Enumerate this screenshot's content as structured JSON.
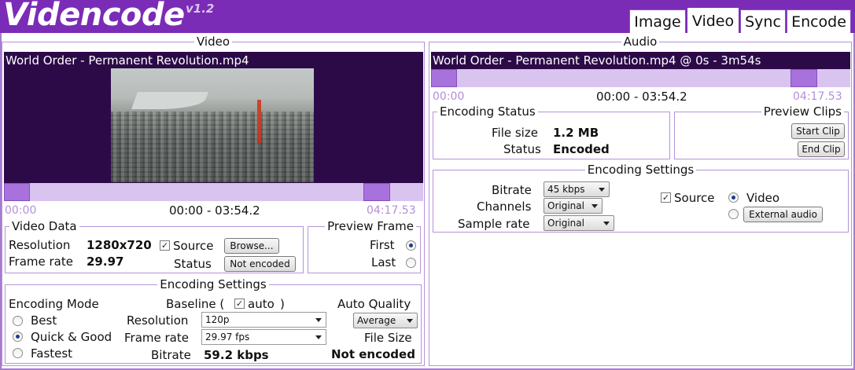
{
  "app": {
    "logo": "Videncode",
    "version": "v1.2"
  },
  "tabs": [
    {
      "label": "Image",
      "active": false
    },
    {
      "label": "Video",
      "active": true
    },
    {
      "label": "Sync",
      "active": false
    },
    {
      "label": "Encode",
      "active": false
    }
  ],
  "video": {
    "legend": "Video",
    "filename": "World Order - Permanent Revolution.mp4",
    "timeline": {
      "start": "00:00",
      "range": "00:00 - 03:54.2",
      "end": "04:17.53"
    },
    "video_data": {
      "legend": "Video Data",
      "resolution_label": "Resolution",
      "resolution_value": "1280x720",
      "framerate_label": "Frame rate",
      "framerate_value": "29.97",
      "source_label": "Source",
      "source_checked": true,
      "browse_button": "Browse...",
      "status_label": "Status",
      "status_button": "Not encoded"
    },
    "preview_frame": {
      "legend": "Preview Frame",
      "first_label": "First",
      "first_selected": true,
      "last_label": "Last",
      "last_selected": false
    },
    "encoding_settings": {
      "legend": "Encoding Settings",
      "mode_label": "Encoding Mode",
      "modes": [
        {
          "label": "Best",
          "selected": false
        },
        {
          "label": "Quick & Good",
          "selected": true
        },
        {
          "label": "Fastest",
          "selected": false
        }
      ],
      "baseline_label": "Baseline (",
      "auto_label": "auto",
      "baseline_close": ")",
      "auto_checked": true,
      "resolution_label": "Resolution",
      "resolution_select": "120p",
      "framerate_label": "Frame rate",
      "framerate_select": "29.97 fps",
      "bitrate_label": "Bitrate",
      "bitrate_value": "59.2 kbps",
      "auto_quality_label": "Auto Quality",
      "auto_quality_select": "Average",
      "file_size_label": "File Size",
      "file_size_value": "Not encoded"
    }
  },
  "audio": {
    "legend": "Audio",
    "title": "World Order - Permanent Revolution.mp4 @ 0s - 3m54s",
    "timeline": {
      "start": "00:00",
      "range": "00:00 - 03:54.2",
      "end": "04:17.53"
    },
    "encoding_status": {
      "legend": "Encoding Status",
      "file_size_label": "File size",
      "file_size_value": "1.2 MB",
      "status_label": "Status",
      "status_value": "Encoded"
    },
    "preview_clips": {
      "legend": "Preview Clips",
      "start_button": "Start Clip",
      "end_button": "End Clip"
    },
    "encoding_settings": {
      "legend": "Encoding Settings",
      "bitrate_label": "Bitrate",
      "bitrate_select": "45 kbps",
      "channels_label": "Channels",
      "channels_select": "Original",
      "samplerate_label": "Sample rate",
      "samplerate_select": "Original",
      "source_label": "Source",
      "source_checked": true,
      "video_option": "Video",
      "video_selected": true,
      "external_button": "External audio",
      "external_selected": false
    }
  },
  "colors": {
    "accent": "#7b2cb6",
    "dark_panel": "#2c0a48",
    "track": "#d9c4f0",
    "handle": "#a872dc",
    "time_muted": "#b48fd9"
  }
}
